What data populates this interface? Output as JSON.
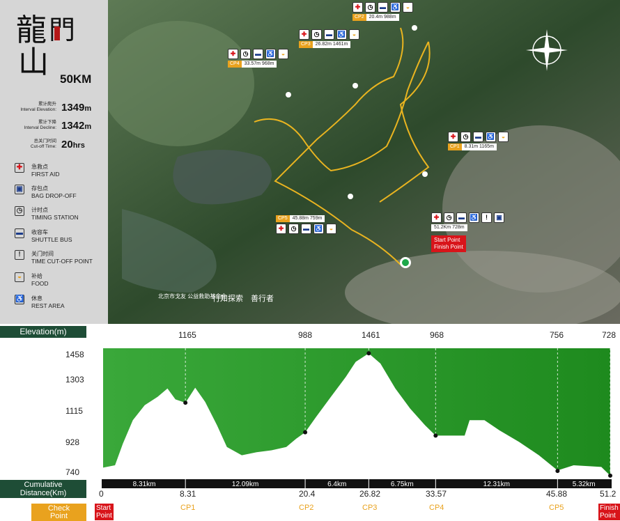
{
  "title": {
    "chinese": "龍門山",
    "distance": "50KM"
  },
  "stats": [
    {
      "cn": "累计爬升",
      "en": "Interval Elevation:",
      "value": "1349",
      "unit": "m"
    },
    {
      "cn": "累计下降",
      "en": "Interval Decline:",
      "value": "1342",
      "unit": "m"
    },
    {
      "cn": "总关门时间",
      "en": "Cut-off Time:",
      "value": "20",
      "unit": "hrs"
    }
  ],
  "legend": [
    {
      "icon": "first-aid-icon",
      "glyph": "✚",
      "color": "#d8141a",
      "cn": "急救点",
      "en": "FIRST AID"
    },
    {
      "icon": "bag-dropoff-icon",
      "glyph": "▣",
      "color": "#1a3a8a",
      "cn": "存包点",
      "en": "BAG DROP-OFF"
    },
    {
      "icon": "timing-station-icon",
      "glyph": "◷",
      "color": "#333333",
      "cn": "计时点",
      "en": "TIMING STATION"
    },
    {
      "icon": "shuttle-bus-icon",
      "glyph": "▬",
      "color": "#1a3a8a",
      "cn": "收容车",
      "en": "SHUTTLE BUS"
    },
    {
      "icon": "cutoff-point-icon",
      "glyph": "!",
      "color": "#333333",
      "cn": "关门时间",
      "en": "TIME CUT-OFF POINT"
    },
    {
      "icon": "food-icon",
      "glyph": "◒",
      "color": "#e9a21e",
      "cn": "补给",
      "en": "FOOD"
    },
    {
      "icon": "rest-area-icon",
      "glyph": "♿",
      "color": "#1a3a8a",
      "cn": "休息",
      "en": "REST AREA"
    }
  ],
  "checkpoints_map": [
    {
      "name": "CP1",
      "info": "8.31m 1165m"
    },
    {
      "name": "CP2",
      "info": "20.4m 988m"
    },
    {
      "name": "CP3",
      "info": "26.82m 1461m"
    },
    {
      "name": "CP4",
      "info": "33.57m 968m"
    },
    {
      "name": "CP5",
      "info": "45.88m 759m"
    }
  ],
  "start_info": "51.2Km 728m",
  "start_label_1": "Start Point",
  "start_label_2": "Finish Point",
  "sponsors": [
    "北京市戈友 公益救助基金会",
    "行知探索",
    "善行者"
  ],
  "elevation": {
    "header": "Elevation(m)",
    "cum_header_1": "Cumulative",
    "cum_header_2": "Distance(Km)",
    "check_1": "Check",
    "check_2": "Point",
    "start_1": "Start",
    "start_2": "Point",
    "finish_1": "Finish",
    "finish_2": "Point",
    "zero": "0"
  },
  "chart_data": {
    "type": "area",
    "ylabel": "Elevation(m)",
    "xlabel": "Cumulative Distance(Km)",
    "ylim": [
      740,
      1458
    ],
    "xlim": [
      0,
      51.2
    ],
    "yticks": [
      "1458",
      "1303",
      "1115",
      "928",
      "740"
    ],
    "profile": [
      [
        0,
        776
      ],
      [
        1.2,
        790
      ],
      [
        2,
        920
      ],
      [
        3,
        1060
      ],
      [
        4.2,
        1150
      ],
      [
        5.5,
        1200
      ],
      [
        6.5,
        1250
      ],
      [
        7.3,
        1185
      ],
      [
        8.31,
        1165
      ],
      [
        9.3,
        1255
      ],
      [
        10.3,
        1170
      ],
      [
        11.5,
        1030
      ],
      [
        12.5,
        900
      ],
      [
        14,
        850
      ],
      [
        15.5,
        868
      ],
      [
        17,
        880
      ],
      [
        18.5,
        900
      ],
      [
        19.5,
        950
      ],
      [
        20.4,
        988
      ],
      [
        21.5,
        1080
      ],
      [
        23,
        1200
      ],
      [
        24.5,
        1320
      ],
      [
        25.5,
        1410
      ],
      [
        26.82,
        1461
      ],
      [
        28,
        1400
      ],
      [
        29.5,
        1250
      ],
      [
        31,
        1130
      ],
      [
        32.5,
        1030
      ],
      [
        33.57,
        968
      ],
      [
        36.5,
        968
      ],
      [
        37,
        1060
      ],
      [
        38.5,
        1060
      ],
      [
        40,
        1000
      ],
      [
        42,
        930
      ],
      [
        44,
        850
      ],
      [
        45.88,
        759
      ],
      [
        47.5,
        790
      ],
      [
        49,
        785
      ],
      [
        50.3,
        780
      ],
      [
        51.2,
        728
      ]
    ],
    "checkpoints": [
      {
        "name": "CP1",
        "km": 8.31,
        "elevation": 1165
      },
      {
        "name": "CP2",
        "km": 20.4,
        "elevation": 988
      },
      {
        "name": "CP3",
        "km": 26.82,
        "elevation": 1461
      },
      {
        "name": "CP4",
        "km": 33.57,
        "elevation": 968
      },
      {
        "name": "CP5",
        "km": 45.88,
        "elevation": 756
      },
      {
        "name": "Finish",
        "km": 51.2,
        "elevation": 728
      }
    ],
    "top_labels": [
      "1165",
      "988",
      "1461",
      "968",
      "756",
      "728"
    ],
    "segments": [
      {
        "label": "8.31km"
      },
      {
        "label": "12.09km"
      },
      {
        "label": "6.4km"
      },
      {
        "label": "6.75km"
      },
      {
        "label": "12.31km"
      },
      {
        "label": "5.32km"
      }
    ],
    "bottom_labels": [
      "8.31",
      "20.4",
      "26.82",
      "33.57",
      "45.88",
      "51.2"
    ]
  }
}
